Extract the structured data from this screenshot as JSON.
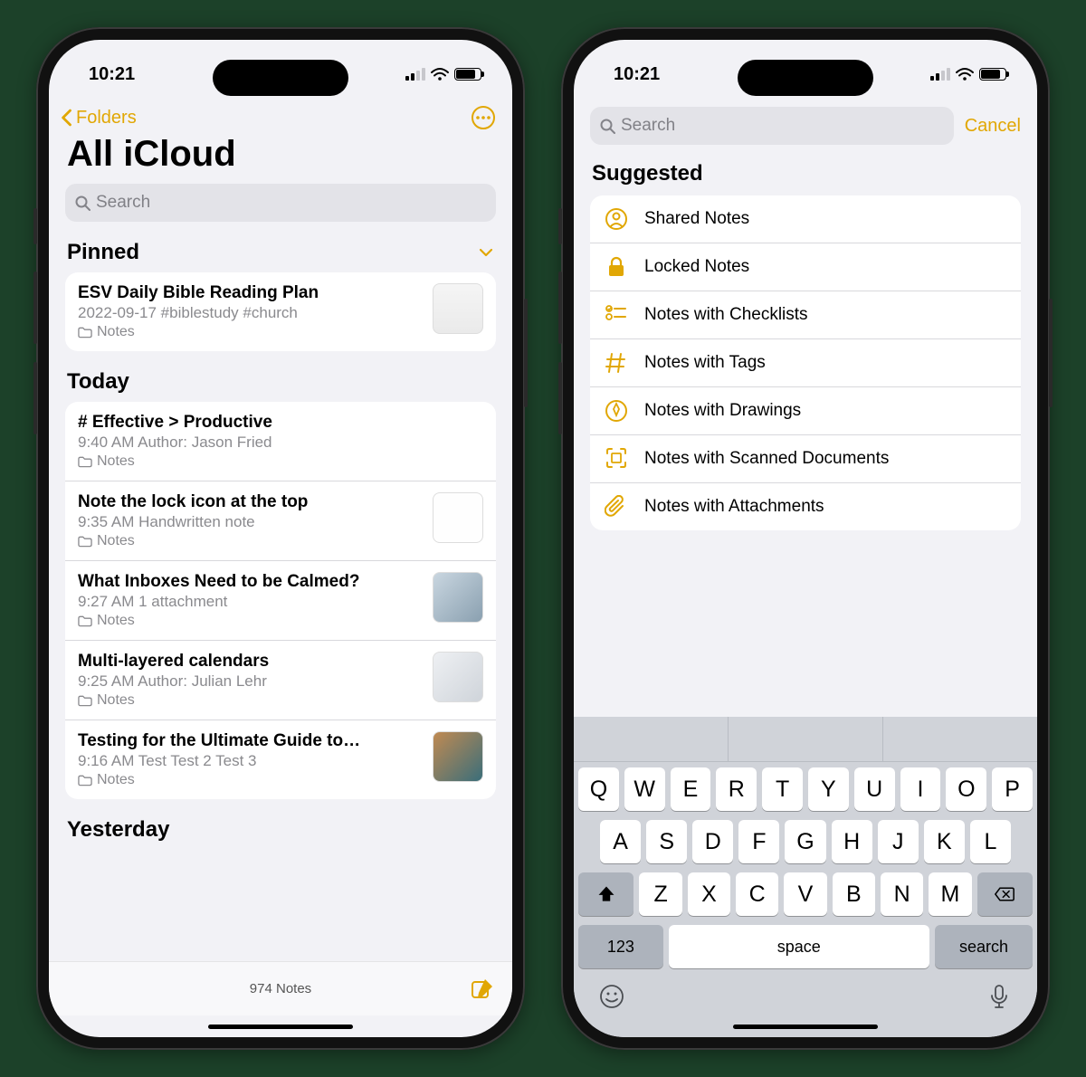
{
  "status": {
    "time": "10:21"
  },
  "left": {
    "back_label": "Folders",
    "title": "All iCloud",
    "search_placeholder": "Search",
    "pinned_header": "Pinned",
    "today_header": "Today",
    "yesterday_header": "Yesterday",
    "footer_count": "974 Notes",
    "pinned": [
      {
        "title": "ESV Daily Bible Reading Plan",
        "subtitle": "2022-09-17  #biblestudy #church",
        "folder": "Notes",
        "thumb": "doc"
      }
    ],
    "today": [
      {
        "title": "# Effective > Productive",
        "subtitle": "9:40 AM  Author: Jason Fried",
        "folder": "Notes",
        "thumb": ""
      },
      {
        "title": "Note the lock icon at the top",
        "subtitle": "9:35 AM  Handwritten note",
        "folder": "Notes",
        "thumb": "hand"
      },
      {
        "title": "What Inboxes Need to be Calmed?",
        "subtitle": "9:27 AM  1 attachment",
        "folder": "Notes",
        "thumb": "photo1"
      },
      {
        "title": "Multi-layered calendars",
        "subtitle": "9:25 AM  Author: Julian Lehr",
        "folder": "Notes",
        "thumb": "photo2"
      },
      {
        "title": "Testing for the Ultimate Guide to…",
        "subtitle": "9:16 AM  Test Test 2 Test 3",
        "folder": "Notes",
        "thumb": "photo3"
      }
    ]
  },
  "right": {
    "search_placeholder": "Search",
    "cancel": "Cancel",
    "suggested_header": "Suggested",
    "suggested": [
      {
        "icon": "person",
        "label": "Shared Notes"
      },
      {
        "icon": "lock",
        "label": "Locked Notes"
      },
      {
        "icon": "checklist",
        "label": "Notes with Checklists"
      },
      {
        "icon": "hash",
        "label": "Notes with Tags"
      },
      {
        "icon": "drawing",
        "label": "Notes with Drawings"
      },
      {
        "icon": "scan",
        "label": "Notes with Scanned Documents"
      },
      {
        "icon": "attach",
        "label": "Notes with Attachments"
      }
    ]
  },
  "keyboard": {
    "row1": [
      "Q",
      "W",
      "E",
      "R",
      "T",
      "Y",
      "U",
      "I",
      "O",
      "P"
    ],
    "row2": [
      "A",
      "S",
      "D",
      "F",
      "G",
      "H",
      "J",
      "K",
      "L"
    ],
    "row3": [
      "Z",
      "X",
      "C",
      "V",
      "B",
      "N",
      "M"
    ],
    "num": "123",
    "space": "space",
    "return": "search"
  }
}
